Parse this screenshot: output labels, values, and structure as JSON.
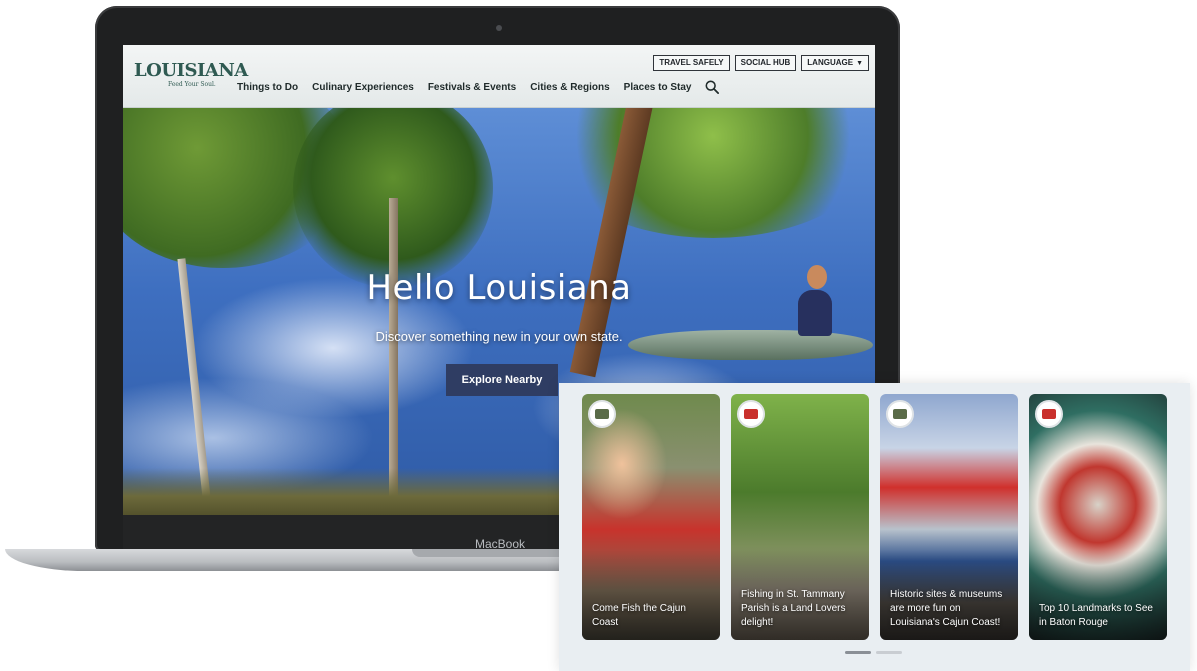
{
  "device": {
    "brand_label": "MacBook"
  },
  "site": {
    "logo_word": "LOUISIANA",
    "logo_tagline": "Feed Your Soul.",
    "utility_nav": [
      {
        "label": "TRAVEL SAFELY"
      },
      {
        "label": "SOCIAL HUB"
      },
      {
        "label": "LANGUAGE"
      }
    ],
    "main_nav": [
      {
        "label": "Things to Do"
      },
      {
        "label": "Culinary Experiences"
      },
      {
        "label": "Festivals & Events"
      },
      {
        "label": "Cities & Regions"
      },
      {
        "label": "Places to Stay"
      }
    ],
    "search_icon": "search-icon"
  },
  "hero": {
    "title": "Hello Louisiana",
    "subtitle": "Discover something new in your own state.",
    "cta_label": "Explore Nearby"
  },
  "stories": {
    "cards": [
      {
        "caption": "Come Fish the Cajun Coast",
        "badge_color": "#5a6b48"
      },
      {
        "caption": "Fishing in St. Tammany Parish is a Land Lovers delight!",
        "badge_color": "#c9302c"
      },
      {
        "caption": "Historic sites & museums are more fun on Louisiana's Cajun Coast!",
        "badge_color": "#5a6b48"
      },
      {
        "caption": "Top 10 Landmarks to See in Baton Rouge",
        "badge_color": "#c9302c"
      }
    ],
    "pager": {
      "active_index": 0,
      "count": 2
    }
  },
  "colors": {
    "header_text": "#1f2a2a",
    "cta_bg": "#2f3d63",
    "pager_active": "#8a8f96",
    "pager_inactive": "#c9cdd2"
  }
}
